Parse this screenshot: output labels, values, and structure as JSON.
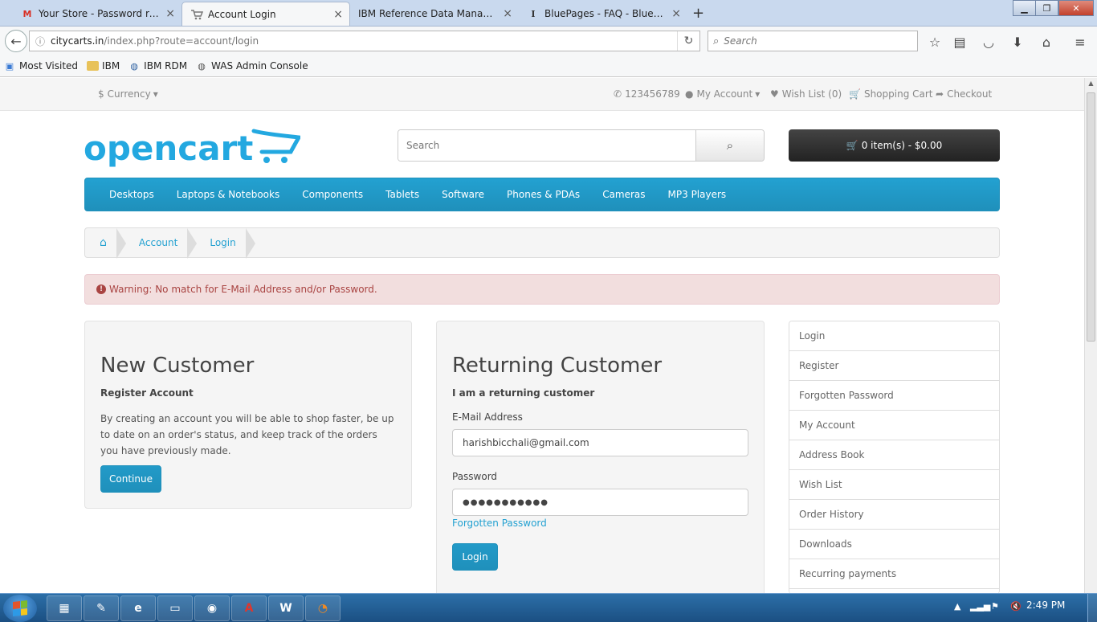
{
  "browser": {
    "tabs": [
      {
        "title": "Your Store - Password rese...",
        "favicon": "M",
        "active": false
      },
      {
        "title": "Account Login",
        "favicon": "cart",
        "active": true
      },
      {
        "title": "IBM Reference Data Managem...",
        "favicon": "",
        "active": false
      },
      {
        "title": "BluePages - FAQ - BluePag...",
        "favicon": "I",
        "active": false
      }
    ],
    "url_domain": "citycarts.in",
    "url_path": "/index.php?route=account/login",
    "search_placeholder": "Search",
    "bookmarks": [
      {
        "label": "Most Visited",
        "icon": "bookmark-icon"
      },
      {
        "label": "IBM",
        "icon": "folder-icon"
      },
      {
        "label": "IBM RDM",
        "icon": "globe-icon"
      },
      {
        "label": "WAS Admin Console",
        "icon": "globe-icon"
      }
    ]
  },
  "store": {
    "topbar": {
      "currency": "Currency",
      "phone": "123456789",
      "my_account": "My Account",
      "wish_list": "Wish List (0)",
      "shopping_cart": "Shopping Cart",
      "checkout": "Checkout"
    },
    "logo_text": "opencart",
    "search_placeholder": "Search",
    "cart_button": "0 item(s) - $0.00",
    "menu": [
      "Desktops",
      "Laptops & Notebooks",
      "Components",
      "Tablets",
      "Software",
      "Phones & PDAs",
      "Cameras",
      "MP3 Players"
    ],
    "breadcrumb": [
      "Account",
      "Login"
    ],
    "alert": "Warning: No match for E-Mail Address and/or Password.",
    "new_customer": {
      "title": "New Customer",
      "subtitle": "Register Account",
      "text": "By creating an account you will be able to shop faster, be up to date on an order's status, and keep track of the orders you have previously made.",
      "button": "Continue"
    },
    "returning_customer": {
      "title": "Returning Customer",
      "subtitle": "I am a returning customer",
      "email_label": "E-Mail Address",
      "email_value": "harishbicchali@gmail.com",
      "password_label": "Password",
      "password_value": "●●●●●●●●●●●",
      "forgotten": "Forgotten Password",
      "button": "Login"
    },
    "account_list": [
      "Login",
      "Register",
      "Forgotten Password",
      "My Account",
      "Address Book",
      "Wish List",
      "Order History",
      "Downloads",
      "Recurring payments"
    ]
  },
  "taskbar": {
    "clock": "2:49 PM",
    "apps": [
      "file-explorer-icon",
      "notes-icon",
      "ie-icon",
      "folder-icon",
      "chrome-icon",
      "acrobat-icon",
      "word-icon",
      "firefox-icon"
    ]
  },
  "colors": {
    "accent": "#229ac8",
    "alert_bg": "#f2dede",
    "alert_text": "#a94442",
    "taskbar": "#1b4f82"
  }
}
